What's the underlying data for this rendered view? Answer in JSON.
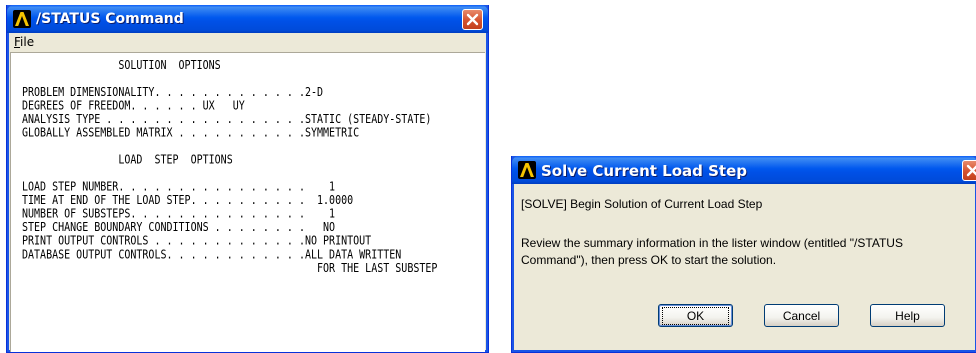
{
  "lister": {
    "title": "/STATUS Command",
    "menu": {
      "file_label_u": "F",
      "file_label_rest": "ile"
    },
    "lines": [
      "                SOLUTION  OPTIONS",
      "",
      "PROBLEM DIMENSIONALITY. . . . . . . . . . . . .2-D",
      "DEGREES OF FREEDOM. . . . . . UX   UY",
      "ANALYSIS TYPE . . . . . . . . . . . . . . . . .STATIC (STEADY-STATE)",
      "GLOBALLY ASSEMBLED MATRIX . . . . . . . . . . .SYMMETRIC",
      "",
      "                LOAD  STEP  OPTIONS",
      "",
      "LOAD STEP NUMBER. . . . . . . . . . . . . . . .    1",
      "TIME AT END OF THE LOAD STEP. . . . . . . . . .  1.0000",
      "NUMBER OF SUBSTEPS. . . . . . . . . . . . . . .    1",
      "STEP CHANGE BOUNDARY CONDITIONS . . . . . . . .   NO",
      "PRINT OUTPUT CONTROLS . . . . . . . . . . . . .NO PRINTOUT",
      "DATABASE OUTPUT CONTROLS. . . . . . . . . . . .ALL DATA WRITTEN",
      "                                                 FOR THE LAST SUBSTEP"
    ]
  },
  "dialog": {
    "title": "Solve Current Load Step",
    "line1": "[SOLVE] Begin Solution of Current Load Step",
    "line2": "Review the summary information in the lister window (entitled  \"/STATUS",
    "line3": "Command\"), then press OK to start the solution.",
    "ok_label": "OK",
    "cancel_label": "Cancel",
    "help_label": "Help"
  }
}
